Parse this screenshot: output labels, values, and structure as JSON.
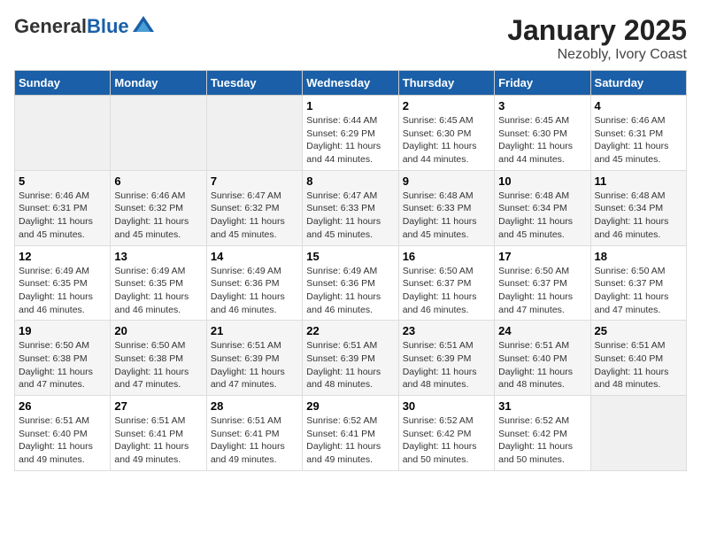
{
  "header": {
    "logo": {
      "general": "General",
      "blue": "Blue"
    },
    "title": "January 2025",
    "subtitle": "Nezobly, Ivory Coast"
  },
  "days_of_week": [
    "Sunday",
    "Monday",
    "Tuesday",
    "Wednesday",
    "Thursday",
    "Friday",
    "Saturday"
  ],
  "weeks": [
    [
      {
        "num": "",
        "sunrise": "",
        "sunset": "",
        "daylight": ""
      },
      {
        "num": "",
        "sunrise": "",
        "sunset": "",
        "daylight": ""
      },
      {
        "num": "",
        "sunrise": "",
        "sunset": "",
        "daylight": ""
      },
      {
        "num": "1",
        "sunrise": "Sunrise: 6:44 AM",
        "sunset": "Sunset: 6:29 PM",
        "daylight": "Daylight: 11 hours and 44 minutes."
      },
      {
        "num": "2",
        "sunrise": "Sunrise: 6:45 AM",
        "sunset": "Sunset: 6:30 PM",
        "daylight": "Daylight: 11 hours and 44 minutes."
      },
      {
        "num": "3",
        "sunrise": "Sunrise: 6:45 AM",
        "sunset": "Sunset: 6:30 PM",
        "daylight": "Daylight: 11 hours and 44 minutes."
      },
      {
        "num": "4",
        "sunrise": "Sunrise: 6:46 AM",
        "sunset": "Sunset: 6:31 PM",
        "daylight": "Daylight: 11 hours and 45 minutes."
      }
    ],
    [
      {
        "num": "5",
        "sunrise": "Sunrise: 6:46 AM",
        "sunset": "Sunset: 6:31 PM",
        "daylight": "Daylight: 11 hours and 45 minutes."
      },
      {
        "num": "6",
        "sunrise": "Sunrise: 6:46 AM",
        "sunset": "Sunset: 6:32 PM",
        "daylight": "Daylight: 11 hours and 45 minutes."
      },
      {
        "num": "7",
        "sunrise": "Sunrise: 6:47 AM",
        "sunset": "Sunset: 6:32 PM",
        "daylight": "Daylight: 11 hours and 45 minutes."
      },
      {
        "num": "8",
        "sunrise": "Sunrise: 6:47 AM",
        "sunset": "Sunset: 6:33 PM",
        "daylight": "Daylight: 11 hours and 45 minutes."
      },
      {
        "num": "9",
        "sunrise": "Sunrise: 6:48 AM",
        "sunset": "Sunset: 6:33 PM",
        "daylight": "Daylight: 11 hours and 45 minutes."
      },
      {
        "num": "10",
        "sunrise": "Sunrise: 6:48 AM",
        "sunset": "Sunset: 6:34 PM",
        "daylight": "Daylight: 11 hours and 45 minutes."
      },
      {
        "num": "11",
        "sunrise": "Sunrise: 6:48 AM",
        "sunset": "Sunset: 6:34 PM",
        "daylight": "Daylight: 11 hours and 46 minutes."
      }
    ],
    [
      {
        "num": "12",
        "sunrise": "Sunrise: 6:49 AM",
        "sunset": "Sunset: 6:35 PM",
        "daylight": "Daylight: 11 hours and 46 minutes."
      },
      {
        "num": "13",
        "sunrise": "Sunrise: 6:49 AM",
        "sunset": "Sunset: 6:35 PM",
        "daylight": "Daylight: 11 hours and 46 minutes."
      },
      {
        "num": "14",
        "sunrise": "Sunrise: 6:49 AM",
        "sunset": "Sunset: 6:36 PM",
        "daylight": "Daylight: 11 hours and 46 minutes."
      },
      {
        "num": "15",
        "sunrise": "Sunrise: 6:49 AM",
        "sunset": "Sunset: 6:36 PM",
        "daylight": "Daylight: 11 hours and 46 minutes."
      },
      {
        "num": "16",
        "sunrise": "Sunrise: 6:50 AM",
        "sunset": "Sunset: 6:37 PM",
        "daylight": "Daylight: 11 hours and 46 minutes."
      },
      {
        "num": "17",
        "sunrise": "Sunrise: 6:50 AM",
        "sunset": "Sunset: 6:37 PM",
        "daylight": "Daylight: 11 hours and 47 minutes."
      },
      {
        "num": "18",
        "sunrise": "Sunrise: 6:50 AM",
        "sunset": "Sunset: 6:37 PM",
        "daylight": "Daylight: 11 hours and 47 minutes."
      }
    ],
    [
      {
        "num": "19",
        "sunrise": "Sunrise: 6:50 AM",
        "sunset": "Sunset: 6:38 PM",
        "daylight": "Daylight: 11 hours and 47 minutes."
      },
      {
        "num": "20",
        "sunrise": "Sunrise: 6:50 AM",
        "sunset": "Sunset: 6:38 PM",
        "daylight": "Daylight: 11 hours and 47 minutes."
      },
      {
        "num": "21",
        "sunrise": "Sunrise: 6:51 AM",
        "sunset": "Sunset: 6:39 PM",
        "daylight": "Daylight: 11 hours and 47 minutes."
      },
      {
        "num": "22",
        "sunrise": "Sunrise: 6:51 AM",
        "sunset": "Sunset: 6:39 PM",
        "daylight": "Daylight: 11 hours and 48 minutes."
      },
      {
        "num": "23",
        "sunrise": "Sunrise: 6:51 AM",
        "sunset": "Sunset: 6:39 PM",
        "daylight": "Daylight: 11 hours and 48 minutes."
      },
      {
        "num": "24",
        "sunrise": "Sunrise: 6:51 AM",
        "sunset": "Sunset: 6:40 PM",
        "daylight": "Daylight: 11 hours and 48 minutes."
      },
      {
        "num": "25",
        "sunrise": "Sunrise: 6:51 AM",
        "sunset": "Sunset: 6:40 PM",
        "daylight": "Daylight: 11 hours and 48 minutes."
      }
    ],
    [
      {
        "num": "26",
        "sunrise": "Sunrise: 6:51 AM",
        "sunset": "Sunset: 6:40 PM",
        "daylight": "Daylight: 11 hours and 49 minutes."
      },
      {
        "num": "27",
        "sunrise": "Sunrise: 6:51 AM",
        "sunset": "Sunset: 6:41 PM",
        "daylight": "Daylight: 11 hours and 49 minutes."
      },
      {
        "num": "28",
        "sunrise": "Sunrise: 6:51 AM",
        "sunset": "Sunset: 6:41 PM",
        "daylight": "Daylight: 11 hours and 49 minutes."
      },
      {
        "num": "29",
        "sunrise": "Sunrise: 6:52 AM",
        "sunset": "Sunset: 6:41 PM",
        "daylight": "Daylight: 11 hours and 49 minutes."
      },
      {
        "num": "30",
        "sunrise": "Sunrise: 6:52 AM",
        "sunset": "Sunset: 6:42 PM",
        "daylight": "Daylight: 11 hours and 50 minutes."
      },
      {
        "num": "31",
        "sunrise": "Sunrise: 6:52 AM",
        "sunset": "Sunset: 6:42 PM",
        "daylight": "Daylight: 11 hours and 50 minutes."
      },
      {
        "num": "",
        "sunrise": "",
        "sunset": "",
        "daylight": ""
      }
    ]
  ]
}
